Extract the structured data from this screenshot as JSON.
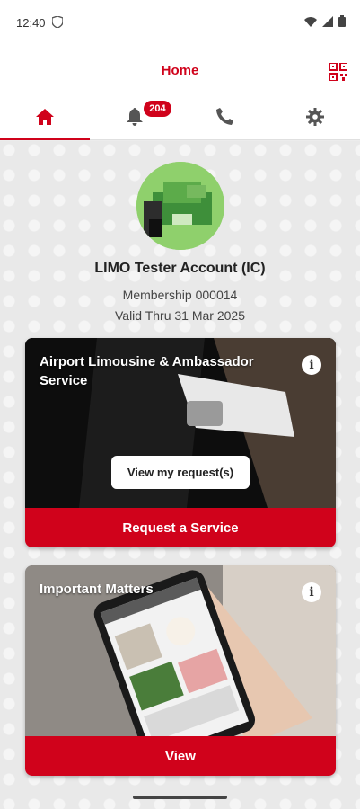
{
  "status": {
    "time": "12:40"
  },
  "appbar": {
    "title": "Home"
  },
  "tabs": {
    "notifications_badge": "204"
  },
  "profile": {
    "name": "LIMO Tester Account (IC)",
    "membership": "Membership 000014",
    "valid": "Valid Thru 31 Mar 2025"
  },
  "cards": [
    {
      "title": "Airport Limousine & Ambassador Service",
      "secondary_button": "View my request(s)",
      "action": "Request a Service"
    },
    {
      "title": "Important Matters",
      "action": "View"
    }
  ],
  "colors": {
    "accent": "#d0021b"
  }
}
